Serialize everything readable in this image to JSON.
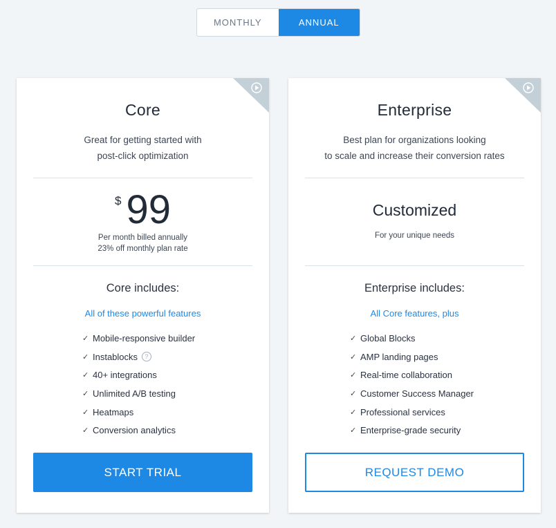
{
  "billing_toggle": {
    "monthly_label": "MONTHLY",
    "annual_label": "ANNUAL",
    "selected": "ANNUAL"
  },
  "colors": {
    "accent": "#1e88e5",
    "page_bg": "#f2f5f7",
    "corner_badge": "#c4d0d8"
  },
  "core": {
    "title": "Core",
    "description_line1": "Great for getting started with",
    "description_line2": "post-click optimization",
    "currency": "$",
    "price": "99",
    "price_note_line1": "Per month billed annually",
    "price_note_line2": "23% off monthly plan rate",
    "includes_heading": "Core includes:",
    "features_subheading": "All of these powerful features",
    "features": [
      "Mobile-responsive builder",
      "Instablocks",
      "40+ integrations",
      "Unlimited A/B testing",
      "Heatmaps",
      "Conversion analytics"
    ],
    "help_glyph": "?",
    "cta_label": "START TRIAL",
    "corner_icon": "play-circle-icon"
  },
  "enterprise": {
    "title": "Enterprise",
    "description_line1": "Best plan for organizations looking",
    "description_line2": "to scale and increase their conversion rates",
    "price_label": "Customized",
    "price_note": "For your unique needs",
    "includes_heading": "Enterprise includes:",
    "features_subheading": "All Core features, plus",
    "features": [
      "Global Blocks",
      "AMP landing pages",
      "Real-time collaboration",
      "Customer Success Manager",
      "Professional services",
      "Enterprise-grade security"
    ],
    "cta_label": "REQUEST DEMO",
    "corner_icon": "play-circle-icon"
  },
  "check_glyph": "✓"
}
